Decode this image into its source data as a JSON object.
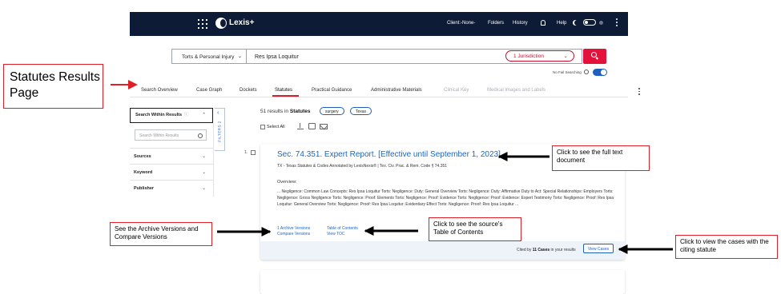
{
  "annotations": {
    "page_label": "Statutes Results Page",
    "full_text": "Click to see the full text document",
    "archive": "See the Archive Versions and Compare Versions",
    "toc": "Click to see the source's Table of Contents",
    "cases": "Click to view the cases with the citing statute"
  },
  "topbar": {
    "logo": "Lexis+",
    "client": "Client:-None-",
    "folders": "Folders",
    "history": "History",
    "help": "Help"
  },
  "search": {
    "content_type": "Torts & Personal Injury",
    "query": "Res Ipsa Loquitur",
    "jurisdiction": "1 Jurisdiction",
    "no_fail": "No Fail Searching"
  },
  "tabs": [
    {
      "label": "Search Overview",
      "dim": false
    },
    {
      "label": "Case Graph",
      "dim": false
    },
    {
      "label": "Dockets",
      "dim": false
    },
    {
      "label": "Statutes",
      "dim": false
    },
    {
      "label": "Practical Guidance",
      "dim": false
    },
    {
      "label": "Administrative Materials",
      "dim": false
    },
    {
      "label": "Clinical Key",
      "dim": true
    },
    {
      "label": "Medical Images and Labels",
      "dim": true
    }
  ],
  "filters": {
    "search_within_title": "Search Within Results",
    "search_within_placeholder": "Search Within Results",
    "facets": [
      "Sources",
      "Keyword",
      "Publisher"
    ],
    "tab_label": "FILTERS 2"
  },
  "results": {
    "count_prefix": "51 results in",
    "content": "Statutes",
    "chips": [
      "surgery",
      "Texas"
    ],
    "select_all": "Select All",
    "item": {
      "number": "1.",
      "title": "Sec. 74.351. Expert Report. [Effective until September 1, 2023]",
      "source": "TX - Texas Statutes & Codes Annotated by LexisNexis® | Tex. Civ. Prac. & Rem. Code § 74.351",
      "overview_label": "Overview:",
      "overview": "... Negligence: Common Law Concepts: Res Ipsa Loquitur Torts: Negligence: Duty: General Overview Torts: Negligence: Duty: Affirmative Duty to Act: Special Relationships: Employers Torts: Negligence: Gross Negligence Torts: Negligence: Proof: Elements Torts: Negligence: Proof: Evidence Torts: Negligence: Proof: Evidence: Expert Testimony Torts: Negligence: Proof: Res Ipsa Loquitur: General Overview Torts: Negligence: Proof: Res Ipsa Loquitur: Evidentiary Effect Torts: Negligence: Proof: Res Ipsa Loquitur ...",
      "archive_versions": "1 Archive Versions",
      "compare_versions": "Compare Versions",
      "toc_label": "Table of Contents",
      "view_toc": "View TOC",
      "cited_prefix": "Cited by",
      "cited_count": "11 Cases",
      "cited_suffix": "in your results",
      "view_cases": "View Cases"
    }
  },
  "colors": {
    "nav_bg": "#0d1b36",
    "brand_red": "#e4123b",
    "link_blue": "#1a66c4",
    "annotation_red": "#e01f26"
  }
}
